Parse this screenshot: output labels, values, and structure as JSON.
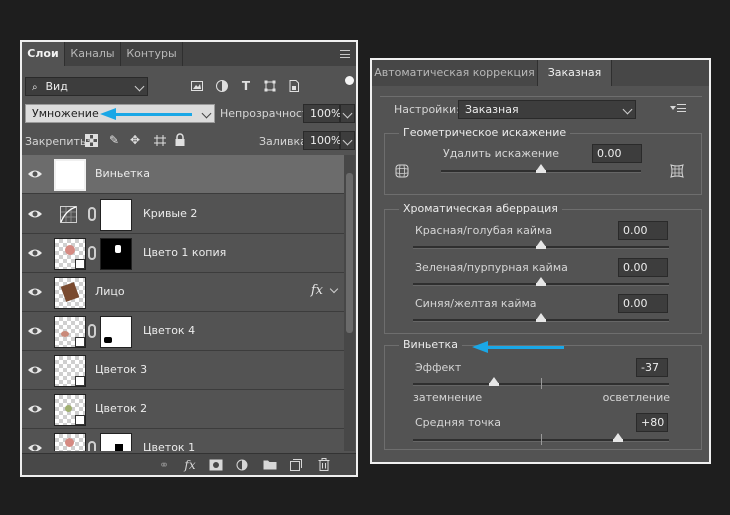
{
  "layers_panel": {
    "tabs": [
      {
        "label": "Слои"
      },
      {
        "label": "Каналы"
      },
      {
        "label": "Контуры"
      }
    ],
    "filter_label": "Вид",
    "blend_mode": "Умножение",
    "opacity_label": "Непрозрачность:",
    "opacity_value": "100%",
    "lock_label": "Закрепить:",
    "fill_label": "Заливка:",
    "fill_value": "100%",
    "layers": [
      {
        "name": "Виньетка"
      },
      {
        "name": "Кривые 2"
      },
      {
        "name": "Цвето 1 копия"
      },
      {
        "name": "Лицо",
        "fx": "fx"
      },
      {
        "name": "Цветок 4"
      },
      {
        "name": "Цветок 3"
      },
      {
        "name": "Цветок 2"
      },
      {
        "name": "Цветок 1"
      }
    ],
    "arrow_color": "#1aa7e6"
  },
  "lens_panel": {
    "tabs": [
      {
        "label": "Автоматическая коррекция"
      },
      {
        "label": "Заказная"
      }
    ],
    "settings_label": "Настройки:",
    "settings_value": "Заказная",
    "geometric": {
      "title": "Геометрическое искажение",
      "remove_label": "Удалить искажение",
      "remove_value": "0.00"
    },
    "chromatic": {
      "title": "Хроматическая аберрация",
      "items": [
        {
          "label": "Красная/голубая кайма",
          "value": "0.00"
        },
        {
          "label": "Зеленая/пурпурная кайма",
          "value": "0.00"
        },
        {
          "label": "Синяя/желтая кайма",
          "value": "0.00"
        }
      ]
    },
    "vignette": {
      "title": "Виньетка",
      "effect_label": "Эффект",
      "effect_value": "-37",
      "darken_label": "затемнение",
      "lighten_label": "осветление",
      "midpoint_label": "Средняя точка",
      "midpoint_value": "+80"
    }
  }
}
